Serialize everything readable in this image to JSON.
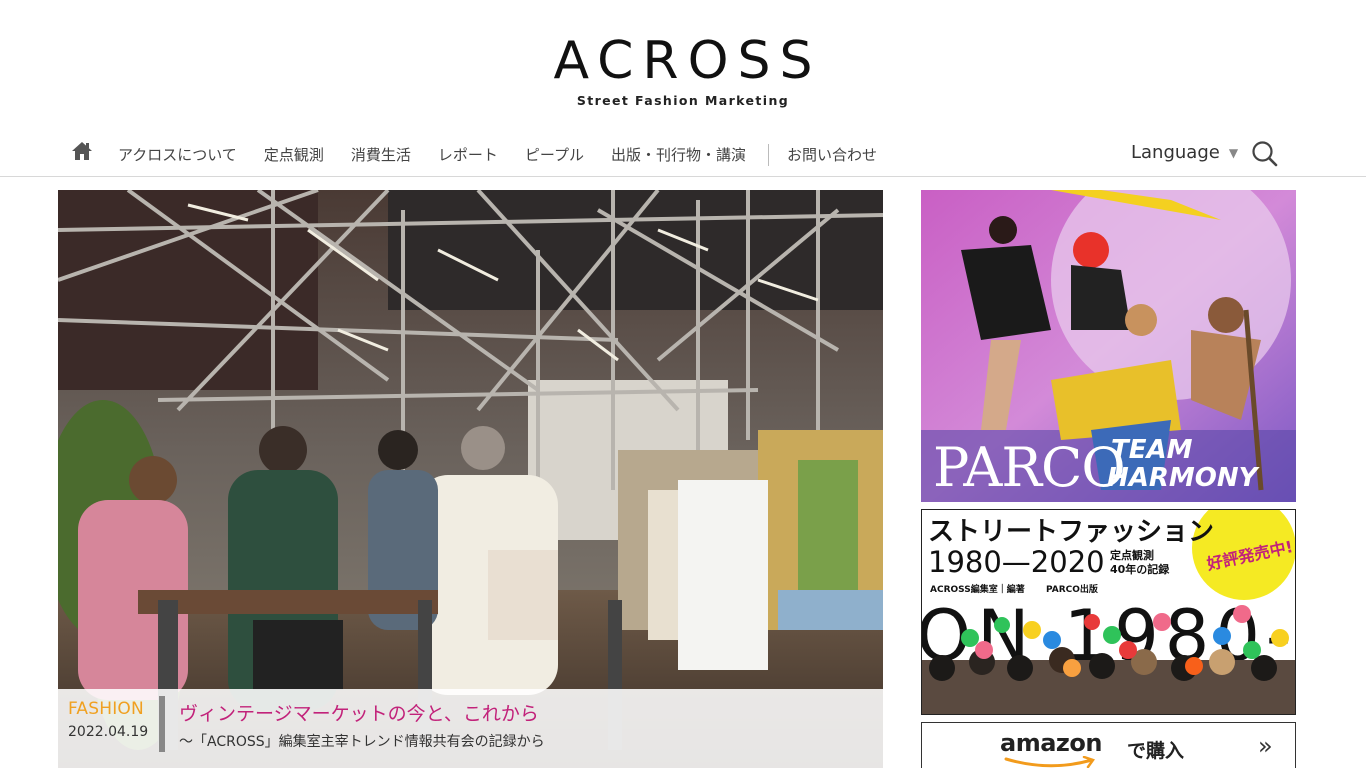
{
  "site": {
    "logo_main": "ACROSS",
    "logo_sub": "Street Fashion Marketing"
  },
  "nav": {
    "home_icon": "home-icon",
    "items": [
      "アクロスについて",
      "定点観測",
      "消費生活",
      "レポート",
      "ピープル",
      "出版・刊行物・講演"
    ],
    "contact": "お問い合わせ",
    "language": "Language",
    "language_arrow": "▼",
    "search_icon": "search-icon"
  },
  "feature": {
    "category": "FASHION",
    "date": "2022.04.19",
    "title": "ヴィンテージマーケットの今と、これから",
    "subtitle": "〜「ACROSS」編集室主宰トレンド情報共有会の記録から",
    "colors": {
      "category": "#f0a020",
      "title": "#c2227a"
    }
  },
  "sidebar": {
    "parco": {
      "brand": "PARCO",
      "team1": "TEAM",
      "team2": "HARMONY"
    },
    "book": {
      "title_line1": "ストリートファッション",
      "years": "1980—2020",
      "desc1": "定点観測",
      "desc2": "40年の記録",
      "badge": "好評発売中!",
      "authors": "ACROSS編集室｜編著",
      "publisher": "PARCO出版",
      "cover_text": "ON 1980-"
    },
    "amazon": {
      "logo": "amazon",
      "buy": "で購入",
      "chevron": "»"
    }
  }
}
